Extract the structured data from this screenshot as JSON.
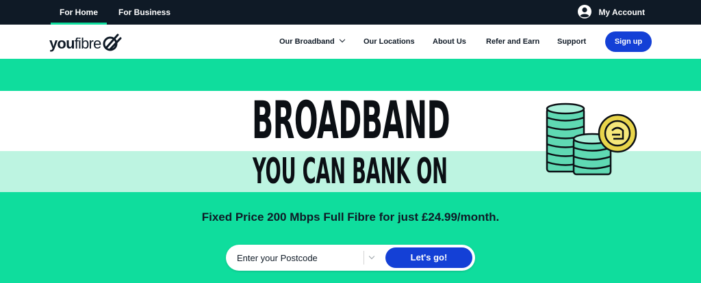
{
  "topbar": {
    "tabs": [
      {
        "label": "For Home",
        "active": true
      },
      {
        "label": "For Business",
        "active": false
      }
    ],
    "account_label": "My Account",
    "account_icon": "user-circle-icon"
  },
  "nav": {
    "logo_bold": "you",
    "logo_light": "fibre",
    "logo_icon": "youfibre-swoosh-icon",
    "links": [
      {
        "label": "Our Broadband",
        "has_dropdown": true
      },
      {
        "label": "Our Locations"
      },
      {
        "label": "About Us"
      },
      {
        "label": "Refer and Earn"
      },
      {
        "label": "Support"
      }
    ],
    "signup_label": "Sign up"
  },
  "hero": {
    "headline_line1": "BROADBAND",
    "headline_line2": "YOU CAN BANK ON",
    "illustration": "coin-stacks-icon",
    "subtitle": "Fixed Price 200 Mbps Full Fibre for just £24.99/month."
  },
  "search": {
    "placeholder": "Enter your Postcode",
    "value": "",
    "button_label": "Let's go!"
  },
  "colors": {
    "brand_green": "#0fdd9d",
    "mint": "#bdf4e1",
    "navy": "#0f1a26",
    "button_blue": "#1440d6"
  }
}
